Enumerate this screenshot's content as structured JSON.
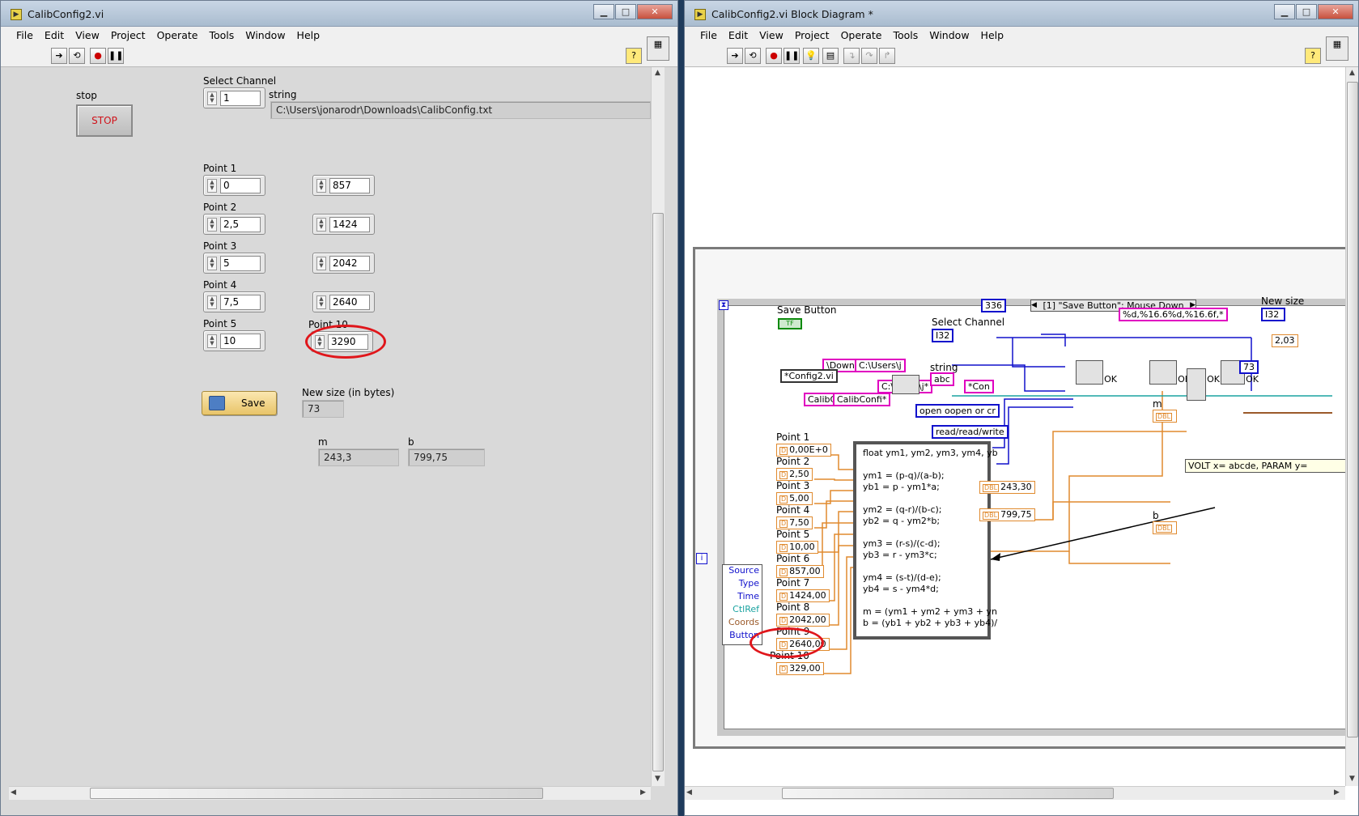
{
  "front_panel": {
    "title": "CalibConfig2.vi",
    "menus": [
      "File",
      "Edit",
      "View",
      "Project",
      "Operate",
      "Tools",
      "Window",
      "Help"
    ],
    "stop_label": "stop",
    "stop_button": "STOP",
    "select_channel_label": "Select Channel",
    "select_channel_value": "1",
    "string_label": "string",
    "string_value": "C:\\Users\\jonarodr\\Downloads\\CalibConfig.txt",
    "points": [
      {
        "label": "Point 1",
        "x": "0",
        "y": "857"
      },
      {
        "label": "Point 2",
        "x": "2,5",
        "y": "1424"
      },
      {
        "label": "Point 3",
        "x": "5",
        "y": "2042"
      },
      {
        "label": "Point 4",
        "x": "7,5",
        "y": "2640"
      },
      {
        "label": "Point 5",
        "x": "10",
        "y": "3290"
      }
    ],
    "point10_label": "Point 10",
    "save_button": "Save",
    "new_size_label": "New size (in bytes)",
    "new_size_value": "73",
    "m_label": "m",
    "m_value": "243,3",
    "b_label": "b",
    "b_value": "799,75"
  },
  "block_diagram": {
    "title": "CalibConfig2.vi Block Diagram *",
    "menus": [
      "File",
      "Edit",
      "View",
      "Project",
      "Operate",
      "Tools",
      "Window",
      "Help"
    ],
    "event_case": "[1] \"Save Button\": Mouse Down",
    "save_button_label": "Save Button",
    "select_channel_label": "Select Channel",
    "string_label": "string",
    "new_size_label": "New size",
    "m_label": "m",
    "b_label": "b",
    "const_336": "336",
    "format_string": "%d,%16.6%d,%16.6f,*",
    "path_const_1": "\\Downl",
    "path_const_2": "C:\\Users\\j",
    "config_const": "*Config2.vi",
    "path_const_3": "C:\\Users\\j*",
    "con_const": "*Con",
    "calib_const_1": "CalibC",
    "calib_const_2": "CalibConfi*",
    "open_const": "open o",
    "open_const_2": "open or cr",
    "rw_const": "read/",
    "rw_const_2": "read/write",
    "const_73": "73",
    "value_203": "2,03",
    "volt_text": "VOLT x= abcde, PARAM y=",
    "point_labels": [
      "Point 1",
      "Point 2",
      "Point 3",
      "Point 4",
      "Point 5",
      "Point 6",
      "Point 7",
      "Point 8",
      "Point 9",
      "Point 10"
    ],
    "point_values": [
      "0,00E+0",
      "2,50",
      "5,00",
      "7,50",
      "10,00",
      "857,00",
      "1424,00",
      "2042,00",
      "2640,00",
      "329,00"
    ],
    "formula_lines": [
      "float ym1, ym2, ym3, ym4, yb",
      "",
      "ym1 = (p-q)/(a-b);",
      "yb1 = p - ym1*a;",
      "",
      "ym2 = (q-r)/(b-c);",
      "yb2 = q - ym2*b;",
      "",
      "ym3 = (r-s)/(c-d);",
      "yb3 = r - ym3*c;",
      "",
      "ym4 = (s-t)/(d-e);",
      "yb4 = s - ym4*d;",
      "",
      "m = (ym1 + ym2 + ym3 + yn",
      "b = (yb1 + yb2 + yb3 + yb4)/"
    ],
    "m_out": "243,30",
    "b_out": "799,75",
    "event_data": [
      "Source",
      "Type",
      "Time",
      "CtlRef",
      "Coords",
      "Button"
    ],
    "ok_labels": [
      "OK",
      "OK",
      "OK",
      "OK"
    ]
  }
}
